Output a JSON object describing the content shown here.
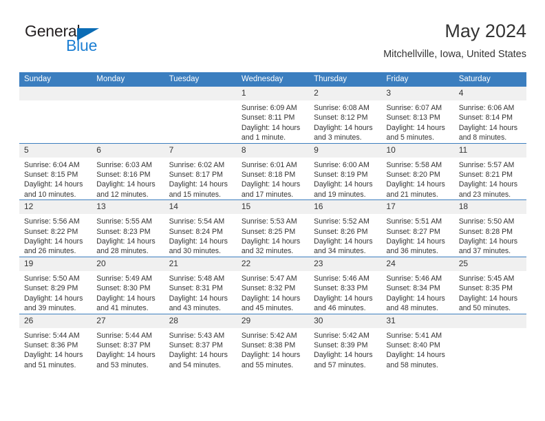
{
  "logo": {
    "word_top": "General",
    "word_bottom": "Blue",
    "triangle_icon": "triangle-icon",
    "color_dark": "#231f20",
    "color_blue": "#1c7fd3"
  },
  "header": {
    "month_title": "May 2024",
    "location": "Mitchellville, Iowa, United States"
  },
  "theme": {
    "header_bar": "#3b7ebf",
    "daynum_band": "#f0f0f0",
    "text": "#333333"
  },
  "calendar": {
    "weekday_headers": [
      "Sunday",
      "Monday",
      "Tuesday",
      "Wednesday",
      "Thursday",
      "Friday",
      "Saturday"
    ],
    "weeks": [
      [
        {
          "day": "",
          "empty": true,
          "sunrise": "",
          "sunset": "",
          "daylight_1": "",
          "daylight_2": ""
        },
        {
          "day": "",
          "empty": true,
          "sunrise": "",
          "sunset": "",
          "daylight_1": "",
          "daylight_2": ""
        },
        {
          "day": "",
          "empty": true,
          "sunrise": "",
          "sunset": "",
          "daylight_1": "",
          "daylight_2": ""
        },
        {
          "day": "1",
          "sunrise": "Sunrise: 6:09 AM",
          "sunset": "Sunset: 8:11 PM",
          "daylight_1": "Daylight: 14 hours",
          "daylight_2": "and 1 minute."
        },
        {
          "day": "2",
          "sunrise": "Sunrise: 6:08 AM",
          "sunset": "Sunset: 8:12 PM",
          "daylight_1": "Daylight: 14 hours",
          "daylight_2": "and 3 minutes."
        },
        {
          "day": "3",
          "sunrise": "Sunrise: 6:07 AM",
          "sunset": "Sunset: 8:13 PM",
          "daylight_1": "Daylight: 14 hours",
          "daylight_2": "and 5 minutes."
        },
        {
          "day": "4",
          "sunrise": "Sunrise: 6:06 AM",
          "sunset": "Sunset: 8:14 PM",
          "daylight_1": "Daylight: 14 hours",
          "daylight_2": "and 8 minutes."
        }
      ],
      [
        {
          "day": "5",
          "sunrise": "Sunrise: 6:04 AM",
          "sunset": "Sunset: 8:15 PM",
          "daylight_1": "Daylight: 14 hours",
          "daylight_2": "and 10 minutes."
        },
        {
          "day": "6",
          "sunrise": "Sunrise: 6:03 AM",
          "sunset": "Sunset: 8:16 PM",
          "daylight_1": "Daylight: 14 hours",
          "daylight_2": "and 12 minutes."
        },
        {
          "day": "7",
          "sunrise": "Sunrise: 6:02 AM",
          "sunset": "Sunset: 8:17 PM",
          "daylight_1": "Daylight: 14 hours",
          "daylight_2": "and 15 minutes."
        },
        {
          "day": "8",
          "sunrise": "Sunrise: 6:01 AM",
          "sunset": "Sunset: 8:18 PM",
          "daylight_1": "Daylight: 14 hours",
          "daylight_2": "and 17 minutes."
        },
        {
          "day": "9",
          "sunrise": "Sunrise: 6:00 AM",
          "sunset": "Sunset: 8:19 PM",
          "daylight_1": "Daylight: 14 hours",
          "daylight_2": "and 19 minutes."
        },
        {
          "day": "10",
          "sunrise": "Sunrise: 5:58 AM",
          "sunset": "Sunset: 8:20 PM",
          "daylight_1": "Daylight: 14 hours",
          "daylight_2": "and 21 minutes."
        },
        {
          "day": "11",
          "sunrise": "Sunrise: 5:57 AM",
          "sunset": "Sunset: 8:21 PM",
          "daylight_1": "Daylight: 14 hours",
          "daylight_2": "and 23 minutes."
        }
      ],
      [
        {
          "day": "12",
          "sunrise": "Sunrise: 5:56 AM",
          "sunset": "Sunset: 8:22 PM",
          "daylight_1": "Daylight: 14 hours",
          "daylight_2": "and 26 minutes."
        },
        {
          "day": "13",
          "sunrise": "Sunrise: 5:55 AM",
          "sunset": "Sunset: 8:23 PM",
          "daylight_1": "Daylight: 14 hours",
          "daylight_2": "and 28 minutes."
        },
        {
          "day": "14",
          "sunrise": "Sunrise: 5:54 AM",
          "sunset": "Sunset: 8:24 PM",
          "daylight_1": "Daylight: 14 hours",
          "daylight_2": "and 30 minutes."
        },
        {
          "day": "15",
          "sunrise": "Sunrise: 5:53 AM",
          "sunset": "Sunset: 8:25 PM",
          "daylight_1": "Daylight: 14 hours",
          "daylight_2": "and 32 minutes."
        },
        {
          "day": "16",
          "sunrise": "Sunrise: 5:52 AM",
          "sunset": "Sunset: 8:26 PM",
          "daylight_1": "Daylight: 14 hours",
          "daylight_2": "and 34 minutes."
        },
        {
          "day": "17",
          "sunrise": "Sunrise: 5:51 AM",
          "sunset": "Sunset: 8:27 PM",
          "daylight_1": "Daylight: 14 hours",
          "daylight_2": "and 36 minutes."
        },
        {
          "day": "18",
          "sunrise": "Sunrise: 5:50 AM",
          "sunset": "Sunset: 8:28 PM",
          "daylight_1": "Daylight: 14 hours",
          "daylight_2": "and 37 minutes."
        }
      ],
      [
        {
          "day": "19",
          "sunrise": "Sunrise: 5:50 AM",
          "sunset": "Sunset: 8:29 PM",
          "daylight_1": "Daylight: 14 hours",
          "daylight_2": "and 39 minutes."
        },
        {
          "day": "20",
          "sunrise": "Sunrise: 5:49 AM",
          "sunset": "Sunset: 8:30 PM",
          "daylight_1": "Daylight: 14 hours",
          "daylight_2": "and 41 minutes."
        },
        {
          "day": "21",
          "sunrise": "Sunrise: 5:48 AM",
          "sunset": "Sunset: 8:31 PM",
          "daylight_1": "Daylight: 14 hours",
          "daylight_2": "and 43 minutes."
        },
        {
          "day": "22",
          "sunrise": "Sunrise: 5:47 AM",
          "sunset": "Sunset: 8:32 PM",
          "daylight_1": "Daylight: 14 hours",
          "daylight_2": "and 45 minutes."
        },
        {
          "day": "23",
          "sunrise": "Sunrise: 5:46 AM",
          "sunset": "Sunset: 8:33 PM",
          "daylight_1": "Daylight: 14 hours",
          "daylight_2": "and 46 minutes."
        },
        {
          "day": "24",
          "sunrise": "Sunrise: 5:46 AM",
          "sunset": "Sunset: 8:34 PM",
          "daylight_1": "Daylight: 14 hours",
          "daylight_2": "and 48 minutes."
        },
        {
          "day": "25",
          "sunrise": "Sunrise: 5:45 AM",
          "sunset": "Sunset: 8:35 PM",
          "daylight_1": "Daylight: 14 hours",
          "daylight_2": "and 50 minutes."
        }
      ],
      [
        {
          "day": "26",
          "sunrise": "Sunrise: 5:44 AM",
          "sunset": "Sunset: 8:36 PM",
          "daylight_1": "Daylight: 14 hours",
          "daylight_2": "and 51 minutes."
        },
        {
          "day": "27",
          "sunrise": "Sunrise: 5:44 AM",
          "sunset": "Sunset: 8:37 PM",
          "daylight_1": "Daylight: 14 hours",
          "daylight_2": "and 53 minutes."
        },
        {
          "day": "28",
          "sunrise": "Sunrise: 5:43 AM",
          "sunset": "Sunset: 8:37 PM",
          "daylight_1": "Daylight: 14 hours",
          "daylight_2": "and 54 minutes."
        },
        {
          "day": "29",
          "sunrise": "Sunrise: 5:42 AM",
          "sunset": "Sunset: 8:38 PM",
          "daylight_1": "Daylight: 14 hours",
          "daylight_2": "and 55 minutes."
        },
        {
          "day": "30",
          "sunrise": "Sunrise: 5:42 AM",
          "sunset": "Sunset: 8:39 PM",
          "daylight_1": "Daylight: 14 hours",
          "daylight_2": "and 57 minutes."
        },
        {
          "day": "31",
          "sunrise": "Sunrise: 5:41 AM",
          "sunset": "Sunset: 8:40 PM",
          "daylight_1": "Daylight: 14 hours",
          "daylight_2": "and 58 minutes."
        },
        {
          "day": "",
          "empty": true,
          "sunrise": "",
          "sunset": "",
          "daylight_1": "",
          "daylight_2": ""
        }
      ]
    ]
  }
}
